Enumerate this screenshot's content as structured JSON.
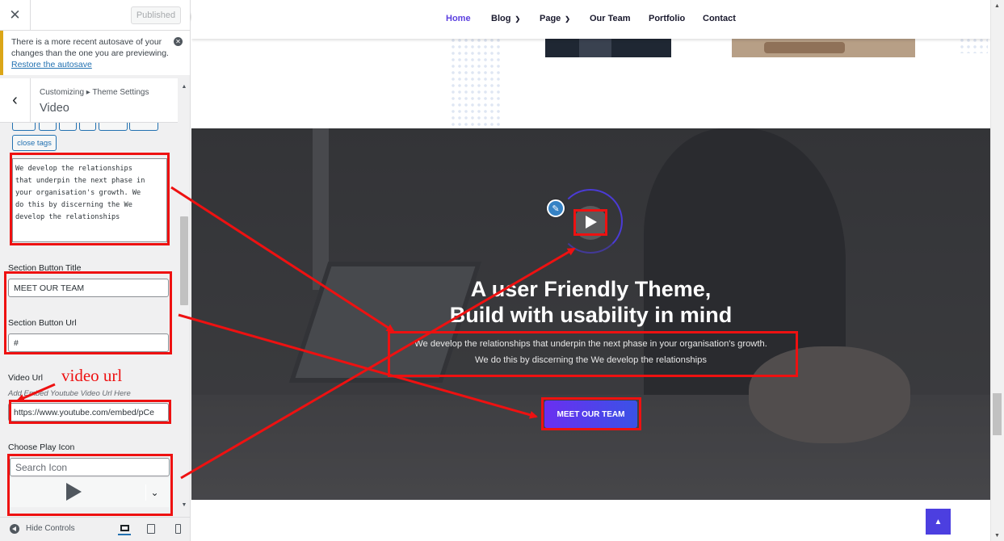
{
  "customizer": {
    "published_label": "Published",
    "notice": {
      "text": "There is a more recent autosave of your changes than the one you are previewing.",
      "link": "Restore the autosave"
    },
    "breadcrumb": "Customizing ▸ Theme Settings",
    "section_title": "Video",
    "close_tags_label": "close tags",
    "description_text": "We develop the relationships\nthat underpin the next phase in\nyour organisation's growth. We\ndo this by discerning the We\ndevelop the relationships",
    "button_title": {
      "label": "Section Button Title",
      "value": "MEET OUR TEAM"
    },
    "button_url": {
      "label": "Section Button Url",
      "value": "#"
    },
    "video_url": {
      "label": "Video Url",
      "description": "Add Embed Youtube Video Url Here",
      "value": "https://www.youtube.com/embed/pCe"
    },
    "play_icon": {
      "label": "Choose Play Icon",
      "placeholder": "Search Icon"
    },
    "footer": {
      "hide_controls": "Hide Controls"
    }
  },
  "preview": {
    "nav": [
      {
        "label": "Home",
        "active": true,
        "dropdown": false
      },
      {
        "label": "Blog",
        "active": false,
        "dropdown": true
      },
      {
        "label": "Page",
        "active": false,
        "dropdown": true
      },
      {
        "label": "Our Team",
        "active": false,
        "dropdown": false
      },
      {
        "label": "Portfolio",
        "active": false,
        "dropdown": false
      },
      {
        "label": "Contact",
        "active": false,
        "dropdown": false
      }
    ],
    "hero": {
      "title_line1": "A user Friendly Theme,",
      "title_line2": "Build with usability in mind",
      "desc_line1": "We develop the relationships that underpin the next phase in your organisation's growth.",
      "desc_line2": "We do this by discerning the We develop the relationships",
      "button": "MEET OUR TEAM"
    }
  },
  "annotation": {
    "note": "video url",
    "color": "#ee1111"
  },
  "colors": {
    "accent": "#5b3fe0",
    "button_start": "#6a2ff0",
    "button_end": "#3a52e6",
    "wp_blue": "#2271b1"
  }
}
